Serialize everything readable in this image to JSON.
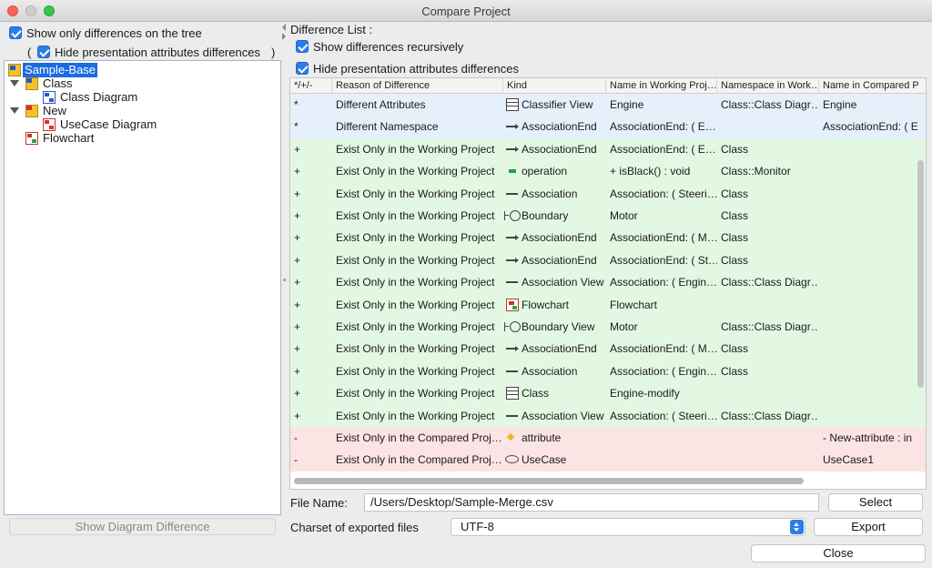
{
  "window": {
    "title": "Compare Project"
  },
  "left": {
    "show_only_diff_label": "Show only differences on the tree",
    "hide_pres_open": "(",
    "hide_pres_label": "Hide presentation attributes differences",
    "hide_pres_close": ")",
    "tree": [
      {
        "label": "Sample-Base",
        "icon": "project-icon"
      },
      {
        "label": "Class",
        "icon": "package-icon"
      },
      {
        "label": "Class Diagram",
        "icon": "class-diagram-icon"
      },
      {
        "label": "New",
        "icon": "package-icon"
      },
      {
        "label": "UseCase Diagram",
        "icon": "usecase-diagram-icon"
      },
      {
        "label": "Flowchart",
        "icon": "flowchart-icon"
      }
    ],
    "show_diagram_diff_button": "Show Diagram Difference"
  },
  "right": {
    "diff_list_label": "Difference List :",
    "show_recursive_label": "Show differences recursively",
    "hide_pres_label": "Hide presentation attributes differences",
    "columns": [
      "*/+/-",
      "Reason of Difference",
      "Kind",
      "Name in Working Proj…",
      "Namespace in Work…",
      "Name in Compared P"
    ],
    "rows": [
      {
        "mark": "*",
        "reason": "Different Attributes",
        "kind": "Classifier View",
        "name": "Engine",
        "ns": "Class::Class Diagr…",
        "cname": "Engine"
      },
      {
        "mark": "*",
        "reason": "Different Namespace",
        "kind": "AssociationEnd",
        "name": "AssociationEnd: ( E…",
        "ns": "",
        "cname": "AssociationEnd: ( E"
      },
      {
        "mark": "+",
        "reason": "Exist Only in the Working Project",
        "kind": "AssociationEnd",
        "name": "AssociationEnd: ( E…",
        "ns": "Class",
        "cname": ""
      },
      {
        "mark": "+",
        "reason": "Exist Only in the Working Project",
        "kind": "operation",
        "name": "+ isBlack() : void",
        "ns": "Class::Monitor",
        "cname": ""
      },
      {
        "mark": "+",
        "reason": "Exist Only in the Working Project",
        "kind": "Association",
        "name": "Association: ( Steeri…",
        "ns": "Class",
        "cname": ""
      },
      {
        "mark": "+",
        "reason": "Exist Only in the Working Project",
        "kind": "Boundary",
        "name": "Motor",
        "ns": "Class",
        "cname": ""
      },
      {
        "mark": "+",
        "reason": "Exist Only in the Working Project",
        "kind": "AssociationEnd",
        "name": "AssociationEnd: ( M…",
        "ns": "Class",
        "cname": ""
      },
      {
        "mark": "+",
        "reason": "Exist Only in the Working Project",
        "kind": "AssociationEnd",
        "name": "AssociationEnd: ( St…",
        "ns": "Class",
        "cname": ""
      },
      {
        "mark": "+",
        "reason": "Exist Only in the Working Project",
        "kind": "Association View",
        "name": "Association: ( Engin…",
        "ns": "Class::Class Diagr…",
        "cname": ""
      },
      {
        "mark": "+",
        "reason": "Exist Only in the Working Project",
        "kind": "Flowchart",
        "name": "Flowchart",
        "ns": "",
        "cname": ""
      },
      {
        "mark": "+",
        "reason": "Exist Only in the Working Project",
        "kind": "Boundary View",
        "name": "Motor",
        "ns": "Class::Class Diagr…",
        "cname": ""
      },
      {
        "mark": "+",
        "reason": "Exist Only in the Working Project",
        "kind": "AssociationEnd",
        "name": "AssociationEnd: ( M…",
        "ns": "Class",
        "cname": ""
      },
      {
        "mark": "+",
        "reason": "Exist Only in the Working Project",
        "kind": "Association",
        "name": "Association: ( Engin…",
        "ns": "Class",
        "cname": ""
      },
      {
        "mark": "+",
        "reason": "Exist Only in the Working Project",
        "kind": "Class",
        "name": "Engine-modify",
        "ns": "",
        "cname": ""
      },
      {
        "mark": "+",
        "reason": "Exist Only in the Working Project",
        "kind": "Association View",
        "name": "Association: ( Steeri…",
        "ns": "Class::Class Diagr…",
        "cname": ""
      },
      {
        "mark": "-",
        "reason": "Exist Only in the Compared Proj…",
        "kind": "attribute",
        "name": "",
        "ns": "",
        "cname": "- New-attribute : in"
      },
      {
        "mark": "-",
        "reason": "Exist Only in the Compared Proj…",
        "kind": "UseCase",
        "name": "",
        "ns": "",
        "cname": "UseCase1"
      }
    ]
  },
  "bottom": {
    "file_name_label": "File Name:",
    "file_name_value": "/Users/Desktop/Sample-Merge.csv",
    "select_button": "Select",
    "charset_label": "Charset of exported files",
    "charset_value": "UTF-8",
    "export_button": "Export",
    "close_button": "Close"
  },
  "colors": {
    "modified_row": "#e6f0fb",
    "added_row": "#e3f8e3",
    "removed_row": "#fbe4e4",
    "accent": "#2b7de9"
  }
}
